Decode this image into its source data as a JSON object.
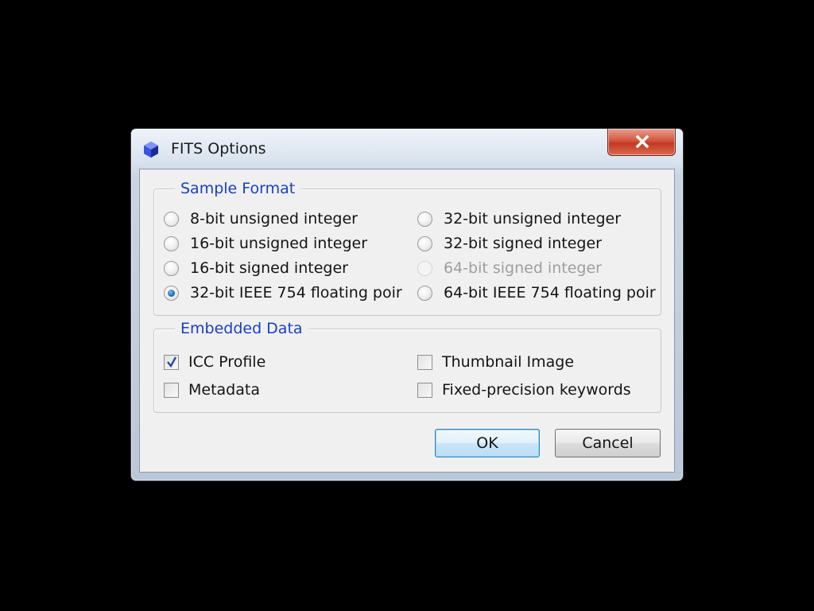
{
  "window": {
    "title": "FITS Options"
  },
  "sample_format": {
    "title": "Sample Format",
    "options": [
      {
        "label": "8-bit unsigned integer",
        "checked": false,
        "enabled": true
      },
      {
        "label": "16-bit unsigned integer",
        "checked": false,
        "enabled": true
      },
      {
        "label": "16-bit signed integer",
        "checked": false,
        "enabled": true
      },
      {
        "label": "32-bit IEEE 754 floating poir",
        "checked": true,
        "enabled": true
      },
      {
        "label": "32-bit unsigned integer",
        "checked": false,
        "enabled": true
      },
      {
        "label": "32-bit signed integer",
        "checked": false,
        "enabled": true
      },
      {
        "label": "64-bit signed integer",
        "checked": false,
        "enabled": false
      },
      {
        "label": "64-bit IEEE 754 floating poir",
        "checked": false,
        "enabled": true
      }
    ]
  },
  "embedded_data": {
    "title": "Embedded Data",
    "options": [
      {
        "label": "ICC Profile",
        "checked": true
      },
      {
        "label": "Metadata",
        "checked": false
      },
      {
        "label": "Thumbnail Image",
        "checked": false
      },
      {
        "label": "Fixed-precision keywords",
        "checked": false
      }
    ]
  },
  "buttons": {
    "ok": "OK",
    "cancel": "Cancel"
  },
  "icons": {
    "app": "fits-app-icon",
    "close": "close-icon"
  },
  "colors": {
    "group_title": "#1a3fc2",
    "close_button": "#c23a23",
    "disabled_text": "#9e9e9e"
  }
}
